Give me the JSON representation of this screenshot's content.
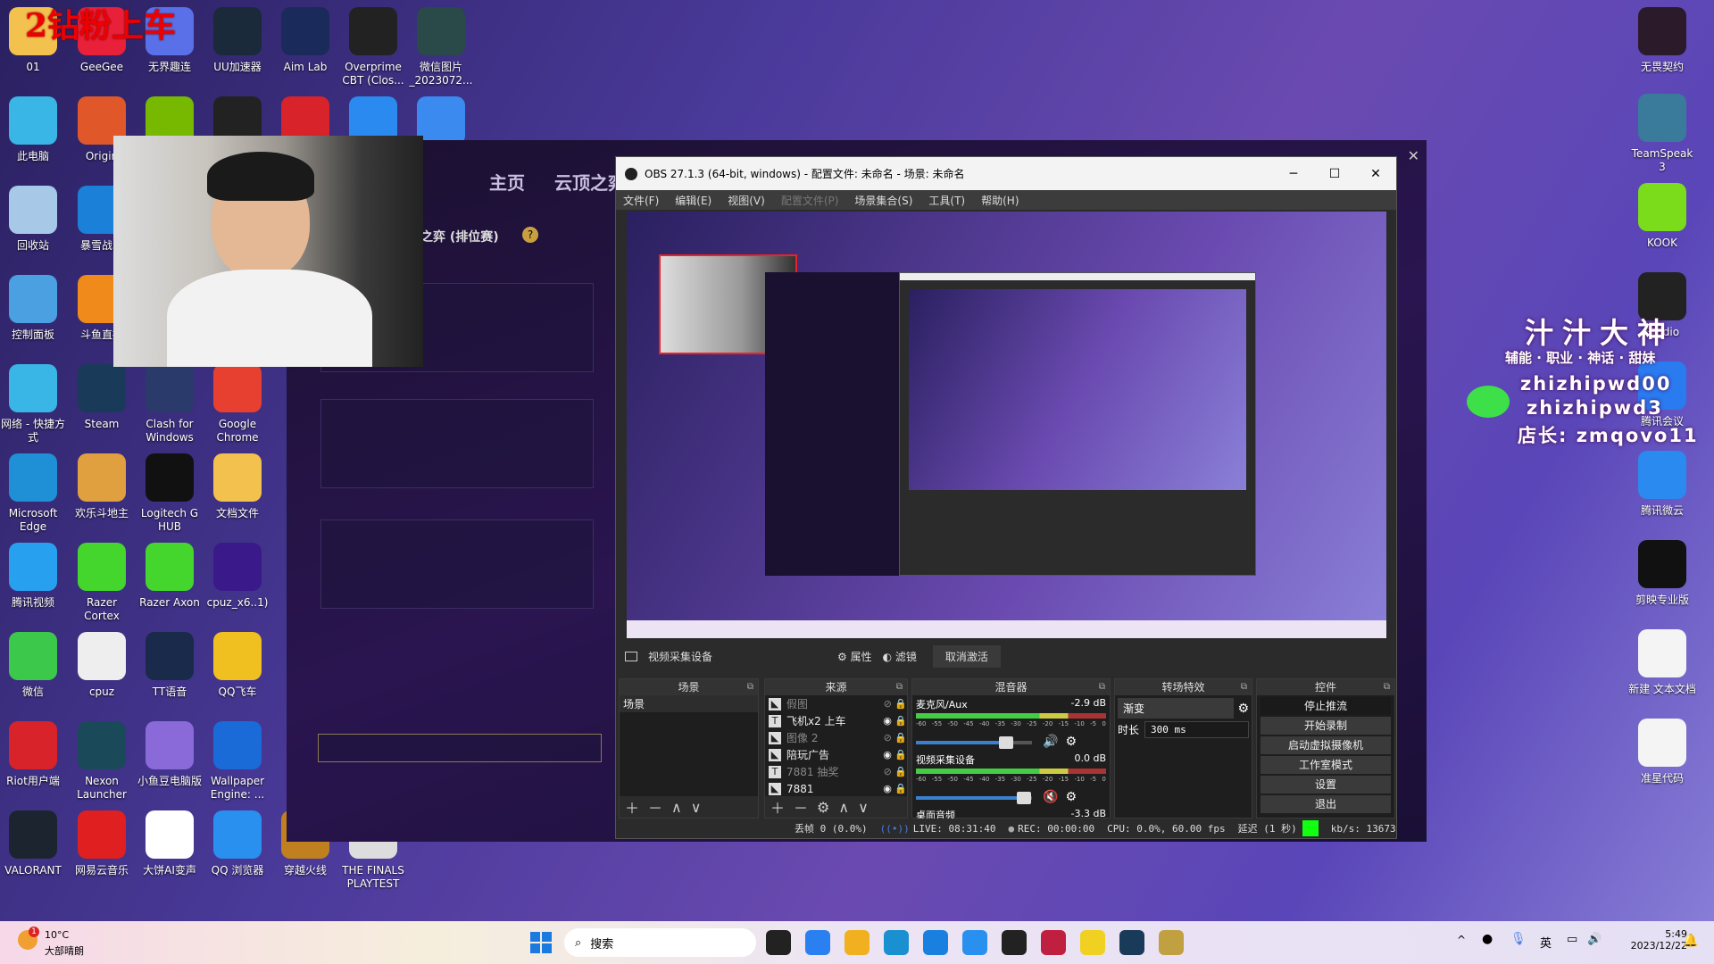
{
  "overlay_text": "2钻粉上车",
  "desktop_left": [
    [
      {
        "label": "01",
        "icon": "folder-icon",
        "color": "#f2c14e"
      },
      {
        "label": "此电脑",
        "icon": "computer-icon",
        "color": "#3ab6e6"
      },
      {
        "label": "回收站",
        "icon": "recycle-bin-icon",
        "color": "#a8c8e8"
      },
      {
        "label": "控制面板",
        "icon": "control-panel-icon",
        "color": "#4aa0e0"
      },
      {
        "label": "网络 - 快捷方式",
        "icon": "network-icon",
        "color": "#3ab6e6"
      },
      {
        "label": "Microsoft Edge",
        "icon": "edge-icon",
        "color": "#1f8fd6"
      },
      {
        "label": "腾讯视频",
        "icon": "tencent-video-icon",
        "color": "#28a0f0"
      },
      {
        "label": "微信",
        "icon": "wechat-icon",
        "color": "#3cc84a"
      },
      {
        "label": "Riot用户端",
        "icon": "riot-icon",
        "color": "#d8232a"
      },
      {
        "label": "VALORANT",
        "icon": "valorant-icon",
        "color": "#1c2430"
      }
    ],
    [
      {
        "label": "GeeGee",
        "icon": "geegee-icon",
        "color": "#e8203a"
      },
      {
        "label": "Origin",
        "icon": "origin-icon",
        "color": "#e0582a"
      },
      {
        "label": "暴雪战网",
        "icon": "battlenet-icon",
        "color": "#1a80d8"
      },
      {
        "label": "斗鱼直播",
        "icon": "douyu-icon",
        "color": "#f08a1a"
      },
      {
        "label": "Steam",
        "icon": "steam-icon",
        "color": "#1a3a5a"
      },
      {
        "label": "欢乐斗地主",
        "icon": "doudizhu-icon",
        "color": "#e0a040"
      },
      {
        "label": "Razer Cortex",
        "icon": "razer-cortex-icon",
        "color": "#44d62c"
      },
      {
        "label": "cpuz",
        "icon": "file-icon",
        "color": "#eeeeee"
      },
      {
        "label": "Nexon Launcher",
        "icon": "nexon-icon",
        "color": "#1a4a5a"
      },
      {
        "label": "网易云音乐",
        "icon": "netease-music-icon",
        "color": "#e02020"
      }
    ],
    [
      {
        "label": "无界趣连",
        "icon": "wujie-icon",
        "color": "#5a70e8"
      },
      {
        "label": "",
        "icon": "nvidia-icon",
        "color": "#76b900"
      },
      {
        "label": "",
        "icon": "app-icon",
        "color": "#444"
      },
      {
        "label": "",
        "icon": "app-icon",
        "color": "#444"
      },
      {
        "label": "Clash for Windows",
        "icon": "clash-icon",
        "color": "#2a3a6a"
      },
      {
        "label": "Logitech G HUB",
        "icon": "logitech-icon",
        "color": "#111"
      },
      {
        "label": "Razer Axon",
        "icon": "razer-axon-icon",
        "color": "#44d62c"
      },
      {
        "label": "TT语音",
        "icon": "tt-voice-icon",
        "color": "#1a2a4a"
      },
      {
        "label": "小鱼豆电脑版",
        "icon": "xiaoyudou-icon",
        "color": "#8a6ad8"
      },
      {
        "label": "大饼AI变声",
        "icon": "voice-changer-icon",
        "color": "#ffffff"
      }
    ],
    [
      {
        "label": "UU加速器",
        "icon": "uu-icon",
        "color": "#1a2a3a"
      },
      {
        "label": "",
        "icon": "app-icon",
        "color": "#222"
      },
      {
        "label": "",
        "icon": "app-icon",
        "color": "#444"
      },
      {
        "label": "",
        "icon": "app-icon",
        "color": "#444"
      },
      {
        "label": "Google Chrome",
        "icon": "chrome-icon",
        "color": "#e84030"
      },
      {
        "label": "文档文件",
        "icon": "folder-icon",
        "color": "#f2c14e"
      },
      {
        "label": "cpuz_x6..1)",
        "icon": "cpuz-icon",
        "color": "#3a1a8a"
      },
      {
        "label": "QQ飞车",
        "icon": "qq-speed-icon",
        "color": "#f0c020"
      },
      {
        "label": "Wallpaper Engine: ...",
        "icon": "wallpaper-engine-icon",
        "color": "#1a6ad8"
      },
      {
        "label": "QQ 浏览器",
        "icon": "qq-browser-icon",
        "color": "#2a90f0"
      }
    ],
    [
      {
        "label": "Aim Lab",
        "icon": "aimlab-icon",
        "color": "#1a2a5a"
      },
      {
        "label": "",
        "icon": "riot-icon",
        "color": "#d8232a"
      },
      {
        "label": "穿越火线",
        "icon": "crossfire-icon",
        "color": "#c08020",
        "row": 9
      }
    ],
    [
      {
        "label": "Overprime CBT (Clos...",
        "icon": "overprime-icon",
        "color": "#222"
      },
      {
        "label": "",
        "icon": "feishu-icon",
        "color": "#2a8af0"
      },
      {
        "label": "THE FINALS PLAYTEST",
        "icon": "the-finals-icon",
        "color": "#ddd",
        "row": 9
      }
    ],
    [
      {
        "label": "微信图片_2023072...",
        "icon": "image-icon",
        "color": "#2a4a4a"
      },
      {
        "label": "",
        "icon": "g-plus-icon",
        "color": "#3a8af0"
      }
    ]
  ],
  "desktop_right": [
    {
      "label": "无畏契约",
      "icon": "valorant-icon",
      "color": "#2a1a2a"
    },
    {
      "label": "TeamSpeak 3",
      "icon": "teamspeak-icon",
      "color": "#3a7a9a"
    },
    {
      "label": "KOOK",
      "icon": "kook-icon",
      "color": "#7adc1a"
    },
    {
      "label": "Studio",
      "icon": "obs-icon",
      "color": "#222"
    },
    {
      "label": "腾讯会议",
      "icon": "tencent-meeting-icon",
      "color": "#2a7af0"
    },
    {
      "label": "腾讯微云",
      "icon": "weiyun-icon",
      "color": "#2a8af0"
    },
    {
      "label": "剪映专业版",
      "icon": "capcut-icon",
      "color": "#111"
    },
    {
      "label": "新建 文本文档",
      "icon": "text-file-icon",
      "color": "#f4f4f4"
    },
    {
      "label": "准星代码",
      "icon": "text-file-icon",
      "color": "#f4f4f4"
    }
  ],
  "stream_overlay": {
    "name": "汁汁大神",
    "tags": "辅能 · 职业 · 神话 · 甜妹",
    "wechat1": "zhizhipwd00",
    "wechat2": "zhizhipwd3",
    "shop": "店长: zmqovo11"
  },
  "game_client": {
    "nav_home": "主页",
    "nav_tft": "云顶之弈",
    "mode": "之弈 (排位赛)",
    "help": "?"
  },
  "obs": {
    "title": "OBS 27.1.3 (64-bit, windows) - 配置文件: 未命名 - 场景: 未命名",
    "menu": [
      {
        "label": "文件(F)"
      },
      {
        "label": "编辑(E)"
      },
      {
        "label": "视图(V)"
      },
      {
        "label": "配置文件(P)",
        "disabled": true
      },
      {
        "label": "场景集合(S)"
      },
      {
        "label": "工具(T)"
      },
      {
        "label": "帮助(H)"
      }
    ],
    "toolbar": {
      "source": "视频采集设备",
      "properties": "属性",
      "filters": "滤镜",
      "deactivate": "取消激活"
    },
    "docks": {
      "scenes": "场景",
      "sources": "来源",
      "mixer": "混音器",
      "transitions": "转场特效",
      "controls": "控件"
    },
    "scenes": [
      "场景"
    ],
    "sources": [
      {
        "name": "假图",
        "type": "image",
        "visible": false
      },
      {
        "name": "飞机x2 上车",
        "type": "text",
        "visible": true
      },
      {
        "name": "图像 2",
        "type": "image",
        "visible": false
      },
      {
        "name": "陪玩广告",
        "type": "image",
        "visible": true
      },
      {
        "name": "7881 抽奖",
        "type": "text",
        "visible": false
      },
      {
        "name": "7881",
        "type": "image",
        "visible": true
      }
    ],
    "mixer": [
      {
        "name": "麦克风/Aux",
        "db": "-2.9 dB",
        "volume": 0.78,
        "muted": false
      },
      {
        "name": "视频采集设备",
        "db": "0.0 dB",
        "volume": 0.93,
        "muted": true
      },
      {
        "name": "桌面音频",
        "db": "-3.3 dB"
      }
    ],
    "meter_ticks": [
      "-60",
      "-55",
      "-50",
      "-45",
      "-40",
      "-35",
      "-30",
      "-25",
      "-20",
      "-15",
      "-10",
      "-5",
      "0"
    ],
    "transition": {
      "type": "渐变",
      "duration_label": "时长",
      "duration": "300 ms"
    },
    "controls": [
      "停止推流",
      "开始录制",
      "启动虚拟摄像机",
      "工作室模式",
      "设置",
      "退出"
    ],
    "status": {
      "dropped": "丢帧 0 (0.0%)",
      "live": "LIVE: 08:31:40",
      "rec": "REC: 00:00:00",
      "cpu": "CPU: 0.0%, 60.00 fps",
      "delay": "延迟 (1 秒)",
      "kbps": "kb/s: 13673"
    }
  },
  "taskbar": {
    "temp": "10°C",
    "weather": "大部晴朗",
    "search": "搜索",
    "ime": "英",
    "time": "5:49",
    "date": "2023/12/22",
    "badge": "1"
  }
}
